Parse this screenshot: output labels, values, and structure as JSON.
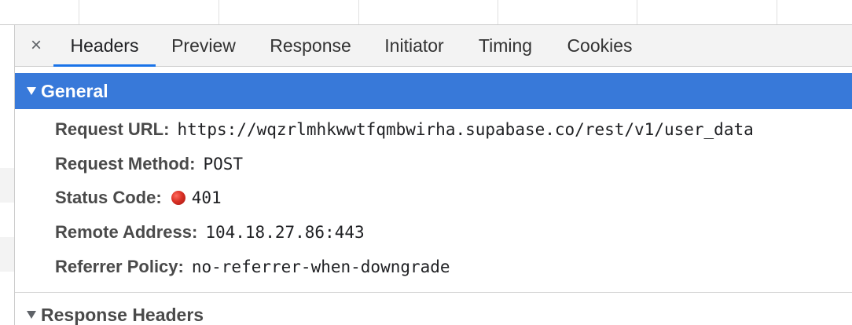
{
  "tabs": {
    "close": "×",
    "items": [
      "Headers",
      "Preview",
      "Response",
      "Initiator",
      "Timing",
      "Cookies"
    ],
    "active": "Headers"
  },
  "general": {
    "title": "General",
    "rows": [
      {
        "key": "Request URL:",
        "value": "https://wqzrlmhkwwtfqmbwirha.supabase.co/rest/v1/user_data"
      },
      {
        "key": "Request Method:",
        "value": "POST"
      },
      {
        "key": "Status Code:",
        "value": "401"
      },
      {
        "key": "Remote Address:",
        "value": "104.18.27.86:443"
      },
      {
        "key": "Referrer Policy:",
        "value": "no-referrer-when-downgrade"
      }
    ]
  },
  "response_headers": {
    "title": "Response Headers"
  },
  "colors": {
    "selected_header": "#3879d9",
    "tab_underline": "#1a73e8",
    "status_error": "#d93025"
  }
}
